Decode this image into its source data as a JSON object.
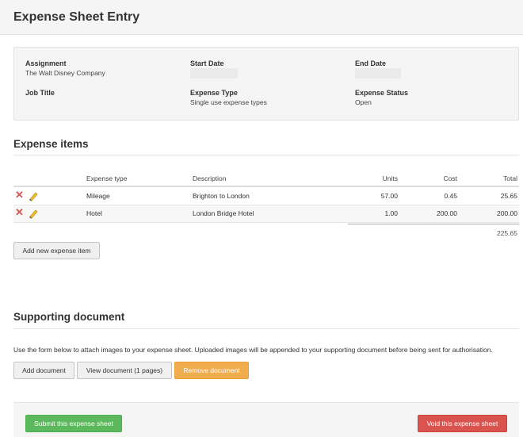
{
  "page": {
    "title": "Expense Sheet Entry"
  },
  "info": {
    "assignment_label": "Assignment",
    "assignment_value": "The Walt Disney Company",
    "start_date_label": "Start Date",
    "end_date_label": "End Date",
    "job_title_label": "Job Title",
    "expense_type_label": "Expense Type",
    "expense_type_value": "Single use expense types",
    "expense_status_label": "Expense Status",
    "expense_status_value": "Open"
  },
  "expense_items": {
    "title": "Expense items",
    "columns": [
      "Expense type",
      "Description",
      "Units",
      "Cost",
      "Total"
    ],
    "rows": [
      {
        "type": "Mileage",
        "description": "Brighton to London",
        "units": "57.00",
        "cost": "0.45",
        "total": "25.65"
      },
      {
        "type": "Hotel",
        "description": "London Bridge Hotel",
        "units": "1.00",
        "cost": "200.00",
        "total": "200.00"
      }
    ],
    "grand_total": "225.65",
    "add_button": "Add new expense item"
  },
  "supporting_document": {
    "title": "Supporting document",
    "help_text": "Use the form below to attach images to your expense sheet. Uploaded images will be appended to your supporting document before being sent for authorisation.",
    "add_button": "Add document",
    "view_button": "View document (1 pages)",
    "remove_button": "Remove document"
  },
  "footer": {
    "submit_button": "Submit this expense sheet",
    "void_button": "Void this expense sheet"
  },
  "icons": {
    "delete": "delete-x-icon",
    "edit": "pencil-edit-icon"
  },
  "colors": {
    "danger": "#d9534f",
    "success": "#5cb85c",
    "warning": "#f0ad4e"
  }
}
